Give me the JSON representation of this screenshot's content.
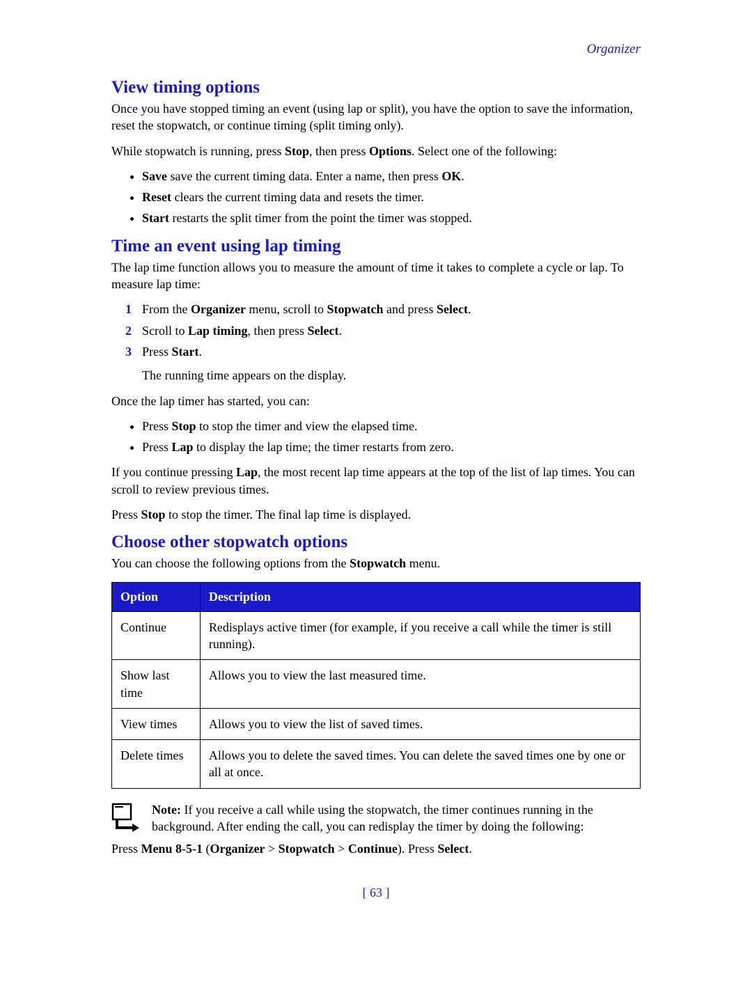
{
  "header": {
    "section": "Organizer"
  },
  "h1": "View timing options",
  "p1": "Once you have stopped timing an event (using lap or split), you have the option to save the information, reset the stopwatch, or continue timing (split timing only).",
  "p2_pre": "While stopwatch is running, press ",
  "p2_b1": "Stop",
  "p2_mid": ", then press ",
  "p2_b2": "Options",
  "p2_post": ". Select one of the following:",
  "opts1": [
    {
      "b": "Save",
      "rest": " save the current timing data. Enter a name, then press ",
      "b2": "OK",
      "tail": "."
    },
    {
      "b": "Reset",
      "rest": " clears the current timing data and resets the timer."
    },
    {
      "b": "Start",
      "rest": " restarts the split timer from the point the timer was stopped."
    }
  ],
  "h2": "Time an event using lap timing",
  "p3": "The lap time function allows you to measure the amount of time it takes to complete a cycle or lap. To measure lap time:",
  "steps": [
    {
      "pre": "From the ",
      "b1": "Organizer",
      "mid": " menu, scroll to ",
      "b2": "Stopwatch",
      "mid2": " and press ",
      "b3": "Select",
      "post": "."
    },
    {
      "pre": "Scroll to ",
      "b1": "Lap timing",
      "mid": ", then press ",
      "b2": "Select",
      "post": "."
    },
    {
      "pre": "Press ",
      "b1": "Start",
      "post": "."
    }
  ],
  "p4": "The running time appears on the display.",
  "p5": "Once the lap timer has started, you can:",
  "opts2": [
    {
      "pre": "Press ",
      "b": "Stop",
      "rest": " to stop the timer and view the elapsed time."
    },
    {
      "pre": "Press ",
      "b": "Lap",
      "rest": " to display the lap time; the timer restarts from zero."
    }
  ],
  "p6_pre": "If you continue pressing ",
  "p6_b": "Lap",
  "p6_post": ", the most recent lap time appears at the top of the list of lap times. You can scroll to review previous times.",
  "p7_pre": "Press ",
  "p7_b": "Stop",
  "p7_post": " to stop the timer. The final lap time is displayed.",
  "h3": "Choose other stopwatch options",
  "p8_pre": "You can choose the following options from the ",
  "p8_b": "Stopwatch",
  "p8_post": " menu.",
  "table": {
    "th1": "Option",
    "th2": "Description",
    "rows": [
      {
        "opt": "Continue",
        "desc": "Redisplays active timer (for example, if you receive a call while the timer is still running)."
      },
      {
        "opt": "Show last time",
        "desc": "Allows you to view the last measured time."
      },
      {
        "opt": "View times",
        "desc": "Allows you to view the list of saved times."
      },
      {
        "opt": "Delete times",
        "desc": "Allows you to delete the saved times. You can delete the saved times one by one or all at once."
      }
    ]
  },
  "note_label": "Note:",
  "note_text": " If you receive a call while using the stopwatch, the timer continues running in the background. After ending the call, you can redisplay the timer by doing the following:",
  "p9_pre": "Press ",
  "p9_b1": "Menu 8-5-1",
  "p9_mid1": " (",
  "p9_b2": "Organizer",
  "p9_mid2": " > ",
  "p9_b3": "Stopwatch",
  "p9_mid3": " > ",
  "p9_b4": "Continue",
  "p9_mid4": "). Press ",
  "p9_b5": "Select",
  "p9_post": ".",
  "page_num": "[ 63 ]"
}
